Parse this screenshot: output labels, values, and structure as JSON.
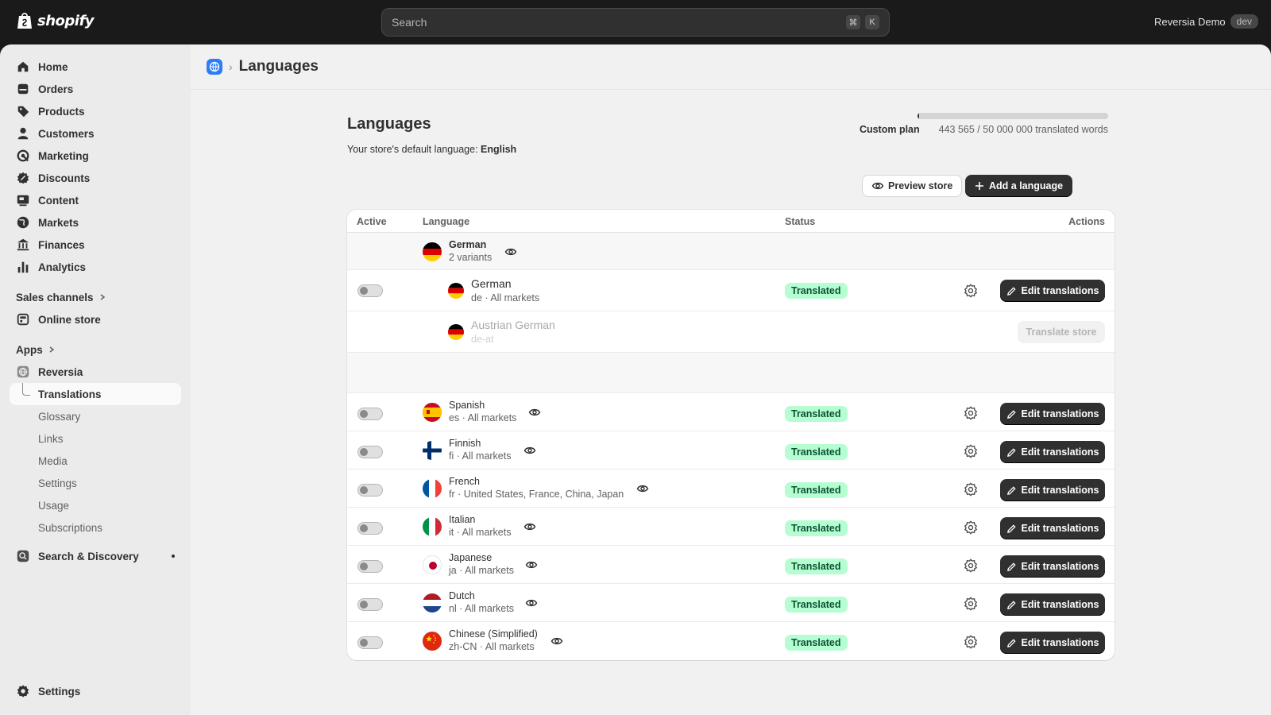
{
  "topbar": {
    "logo": "shopify",
    "search_placeholder": "Search",
    "shortcut_keys": [
      "⌘",
      "K"
    ],
    "store_name": "Reversia Demo",
    "store_badge": "dev"
  },
  "sidebar": {
    "items": [
      {
        "label": "Home",
        "icon": "home-icon"
      },
      {
        "label": "Orders",
        "icon": "orders-icon"
      },
      {
        "label": "Products",
        "icon": "tag-icon"
      },
      {
        "label": "Customers",
        "icon": "person-icon"
      },
      {
        "label": "Marketing",
        "icon": "target-icon"
      },
      {
        "label": "Discounts",
        "icon": "discount-icon"
      },
      {
        "label": "Content",
        "icon": "content-icon"
      },
      {
        "label": "Markets",
        "icon": "globe-icon"
      },
      {
        "label": "Finances",
        "icon": "bank-icon"
      },
      {
        "label": "Analytics",
        "icon": "bar-chart-icon"
      }
    ],
    "sales_channels_label": "Sales channels",
    "online_store_label": "Online store",
    "apps_label": "Apps",
    "app_name": "Reversia",
    "app_sub_items": [
      "Translations",
      "Glossary",
      "Links",
      "Media",
      "Settings",
      "Usage",
      "Subscriptions"
    ],
    "search_discovery_label": "Search & Discovery",
    "settings_label": "Settings"
  },
  "breadcrumb": {
    "title": "Languages"
  },
  "page": {
    "title": "Languages",
    "default_language_prefix": "Your store's default language:",
    "default_language": "English",
    "plan_name": "Custom plan",
    "plan_usage": "443 565 / 50 000 000 translated words",
    "plan_fraction": 0.0089,
    "preview_button": "Preview store",
    "add_button": "Add a language"
  },
  "table": {
    "headers": {
      "active": "Active",
      "language": "Language",
      "status": "Status",
      "actions": "Actions"
    },
    "group": {
      "name": "German",
      "sub": "2 variants"
    },
    "variants": [
      {
        "name": "German",
        "sub": "de · All markets",
        "status": "Translated",
        "action": "Edit translations"
      },
      {
        "name": "Austrian German",
        "sub": "de-at",
        "action": "Translate store"
      }
    ],
    "rows": [
      {
        "name": "Spanish",
        "sub": "es · All markets",
        "status": "Translated",
        "action": "Edit translations",
        "flag": "es"
      },
      {
        "name": "Finnish",
        "sub": "fi · All markets",
        "status": "Translated",
        "action": "Edit translations",
        "flag": "fi"
      },
      {
        "name": "French",
        "sub": "fr · United States, France, China, Japan",
        "status": "Translated",
        "action": "Edit translations",
        "flag": "fr"
      },
      {
        "name": "Italian",
        "sub": "it · All markets",
        "status": "Translated",
        "action": "Edit translations",
        "flag": "it"
      },
      {
        "name": "Japanese",
        "sub": "ja · All markets",
        "status": "Translated",
        "action": "Edit translations",
        "flag": "ja"
      },
      {
        "name": "Dutch",
        "sub": "nl · All markets",
        "status": "Translated",
        "action": "Edit translations",
        "flag": "nl"
      },
      {
        "name": "Chinese (Simplified)",
        "sub": "zh-CN · All markets",
        "status": "Translated",
        "action": "Edit translations",
        "flag": "zh"
      }
    ]
  },
  "colors": {
    "status_bg": "#b4fed2",
    "status_text": "#0c5132",
    "primary_button": "#303030",
    "app_icon": "#2e7cf6"
  }
}
